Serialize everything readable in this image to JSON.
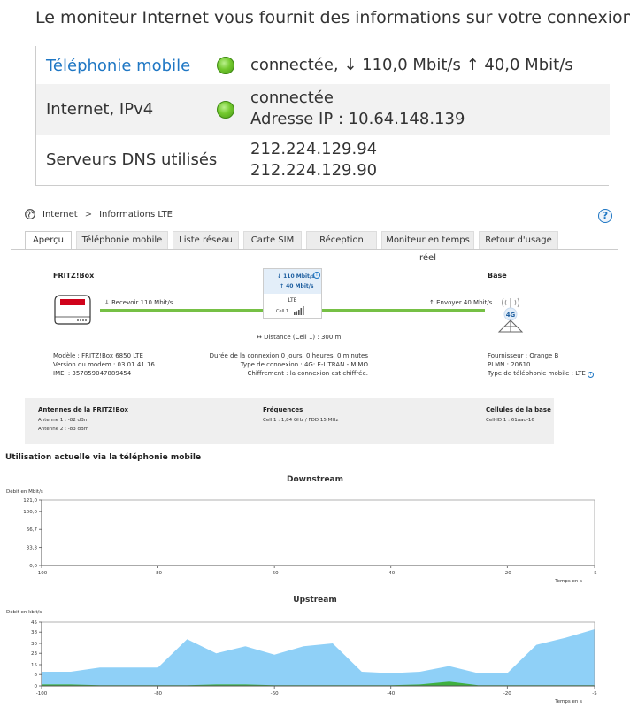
{
  "monitor": {
    "intro": "Le moniteur Internet vous fournit des informations sur votre connexion Intern",
    "rows": [
      {
        "label": "Téléphonie mobile",
        "status_color": "#6cc42a",
        "value_line1": "connectée, ↓ 110,0 Mbit/s ↑ 40,0 Mbit/s",
        "value_line2": ""
      },
      {
        "label": "Internet, IPv4",
        "status_color": "#6cc42a",
        "value_line1": "connectée",
        "value_line2": "Adresse IP : 10.64.148.139"
      },
      {
        "label": "Serveurs DNS utilisés",
        "value_line1": "212.224.129.94",
        "value_line2": "212.224.129.90"
      }
    ]
  },
  "breadcrumb": {
    "root": "Internet",
    "separator": ">",
    "current": "Informations LTE"
  },
  "help": {
    "label": "?"
  },
  "tabs": [
    {
      "label": "Aperçu",
      "active": true
    },
    {
      "label": "Téléphonie mobile",
      "active": false
    },
    {
      "label": "Liste réseau",
      "active": false
    },
    {
      "label": "Carte SIM",
      "active": false
    },
    {
      "label": "Réception",
      "active": false
    },
    {
      "label": "Moniteur en temps réel",
      "active": false
    },
    {
      "label": "Retour d'usage",
      "active": false
    }
  ],
  "overview": {
    "fritz_title": "FRITZ!Box",
    "base_title": "Base",
    "receive": "↓ Recevoir 110 Mbit/s",
    "send": "↑ Envoyer 40 Mbit/s",
    "lte_down": "↓ 110 Mbit/s",
    "lte_up": "↑ 40 Mbit/s",
    "lte_label": "LTE",
    "cell_label": "Cell 1",
    "tower_badge": "4G",
    "distance": "↔ Distance (Cell 1) : 300 m",
    "device": {
      "model": "Modèle : FRITZ!Box 6850 LTE",
      "modem": "Version du modem : 03.01.41.16",
      "imei": "IMEI : 357859047889454"
    },
    "connection": {
      "duration": "Durée de la connexion 0 jours, 0 heures, 0 minutes",
      "type": "Type de connexion : 4G: E-UTRAN - MIMO",
      "encryption": "Chiffrement : la connexion est chiffrée."
    },
    "provider": {
      "provider": "Fournisseur : Orange B",
      "plmn": "PLMN : 20610",
      "phone_type": "Type de téléphonie mobile : LTE"
    }
  },
  "details": {
    "antennas": {
      "title": "Antennes de la FRITZ!Box",
      "a1": "Antenne 1 : -82 dBm",
      "a2": "Antenne 2 : -83 dBm"
    },
    "frequencies": {
      "title": "Fréquences",
      "f1": "Cell 1 : 1,84 GHz / FDD 15 MHz"
    },
    "cells": {
      "title": "Cellules de la base",
      "c1": "Cell-ID 1 : 61aad-16"
    }
  },
  "usage_title": "Utilisation actuelle via la téléphonie mobile",
  "chart_data": [
    {
      "type": "area",
      "title": "Downstream",
      "ylabel": "Débit en Mbit/s",
      "xlabel": "Temps en s",
      "ylim": [
        0,
        121
      ],
      "yticks": [
        "0,0",
        "33,3",
        "66,7",
        "100,0",
        "121,0"
      ],
      "ytick_values": [
        0,
        33.3,
        66.7,
        100,
        121
      ],
      "xlim": [
        -100,
        -5
      ],
      "xticks": [
        -100,
        -80,
        -60,
        -40,
        -20,
        -5
      ],
      "x": [
        -100,
        -5
      ],
      "series": [
        {
          "values": [
            0,
            0
          ],
          "color": "#8fd0f7"
        }
      ],
      "grid": false
    },
    {
      "type": "area",
      "title": "Upstream",
      "ylabel": "Débit en kbit/s",
      "xlabel": "Temps en s",
      "ylim": [
        0,
        45
      ],
      "yticks": [
        "0",
        "8",
        "15",
        "23",
        "30",
        "38",
        "45"
      ],
      "ytick_values": [
        0,
        8,
        15,
        23,
        30,
        38,
        45
      ],
      "xlim": [
        -100,
        -5
      ],
      "xticks": [
        -100,
        -80,
        -60,
        -40,
        -20,
        -5
      ],
      "x": [
        -100,
        -95,
        -90,
        -85,
        -80,
        -75,
        -70,
        -65,
        -60,
        -55,
        -50,
        -45,
        -40,
        -35,
        -30,
        -25,
        -20,
        -15,
        -10,
        -5
      ],
      "series": [
        {
          "values": [
            10,
            10,
            13,
            13,
            13,
            33,
            23,
            28,
            22,
            28,
            30,
            10,
            9,
            10,
            14,
            9,
            9,
            29,
            34,
            40
          ],
          "color": "#8fd0f7"
        },
        {
          "values": [
            1,
            1,
            0.5,
            0.5,
            0.5,
            0.5,
            1,
            1,
            0.5,
            0.5,
            0.5,
            0.5,
            0.5,
            1,
            3,
            0.5,
            0.5,
            0.5,
            0.5,
            0.5
          ],
          "color": "#3fb03f"
        }
      ],
      "grid": false
    }
  ]
}
